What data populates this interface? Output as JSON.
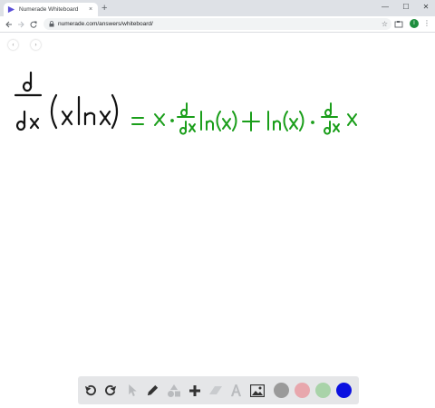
{
  "browser": {
    "tab_title": "Numerade Whiteboard",
    "tab_close": "×",
    "new_tab": "+",
    "url": "numerade.com/answers/whiteboard/",
    "avatar_letter": "I",
    "window_controls": [
      "—",
      "☐",
      "✕"
    ]
  },
  "whiteboard": {
    "ink_colors": {
      "black": "#111111",
      "green": "#1a9e1a"
    }
  },
  "palette": {
    "tools": [
      "undo-icon",
      "redo-icon",
      "cursor-icon",
      "pen-icon",
      "shapes-icon",
      "plus-icon",
      "eraser-icon",
      "text-icon",
      "image-icon"
    ],
    "swatches": [
      "#9a9a9a",
      "#e8a7ad",
      "#a9d3a9",
      "#0b10e0"
    ]
  },
  "colors": {
    "accent": "#1a73e8",
    "palette_bg": "#e5e6e8"
  }
}
